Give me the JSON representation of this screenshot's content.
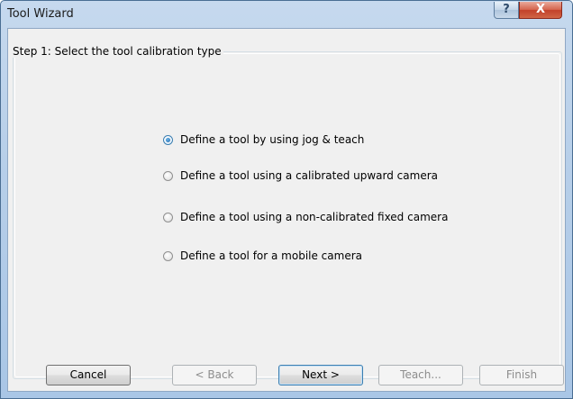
{
  "window": {
    "title": "Tool Wizard",
    "help_glyph": "?",
    "close_glyph": "X"
  },
  "step": {
    "label": "Step 1: Select the tool calibration type"
  },
  "options": [
    {
      "label": "Define a tool by using jog & teach",
      "checked": true
    },
    {
      "label": "Define a tool using a calibrated upward camera",
      "checked": false
    },
    {
      "label": "Define a tool using a non-calibrated fixed camera",
      "checked": false
    },
    {
      "label": "Define a tool for a mobile camera",
      "checked": false
    }
  ],
  "buttons": {
    "cancel": "Cancel",
    "back": "< Back",
    "next": "Next >",
    "teach": "Teach...",
    "finish": "Finish"
  },
  "icons": {
    "help": "help-icon",
    "close": "close-icon",
    "radio_checked": "radio-checked-icon",
    "radio_unchecked": "radio-unchecked-icon"
  },
  "colors": {
    "title_bar": "#b7cfe9",
    "close_button": "#c2412a",
    "client_background": "#f0f0f0",
    "radio_selected": "#1f66a8",
    "disabled_text": "#8d8d8d"
  }
}
